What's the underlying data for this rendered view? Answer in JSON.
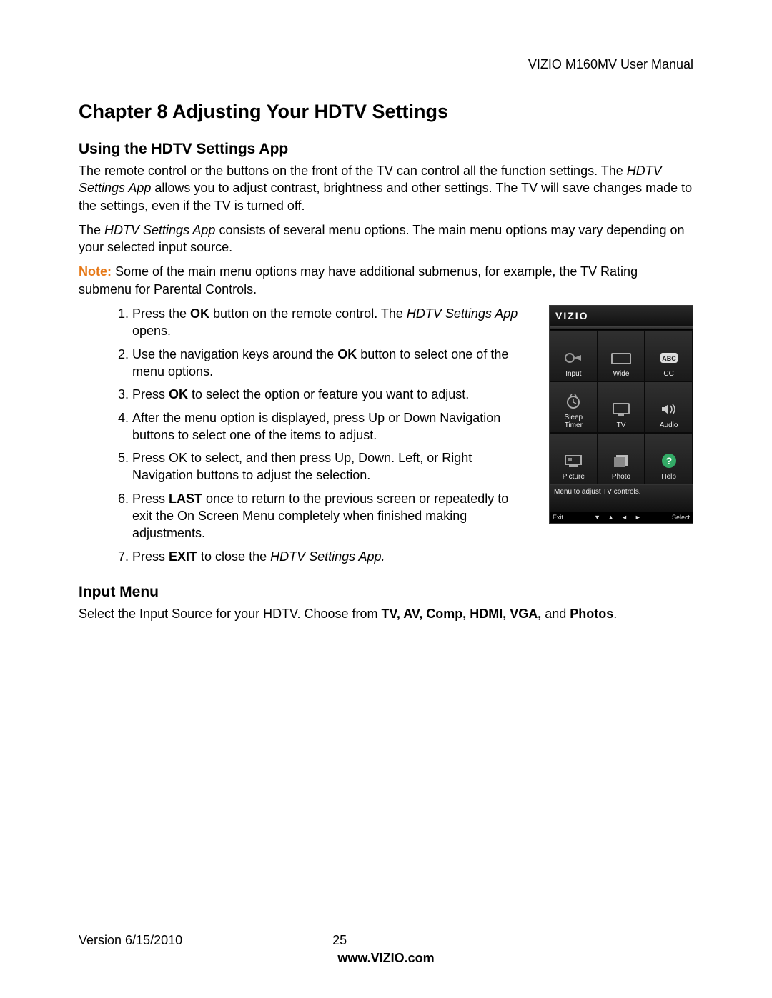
{
  "header": {
    "title": "VIZIO M160MV User Manual"
  },
  "chapter": {
    "title": "Chapter 8 Adjusting Your HDTV Settings"
  },
  "section1": {
    "title": "Using the HDTV Settings App",
    "p1_a": "The remote control or the buttons on the front of the TV can control all the function settings. The ",
    "p1_b": "HDTV Settings App",
    "p1_c": " allows you to adjust contrast, brightness and other settings. The TV will save changes made to the settings, even if the TV is turned off.",
    "p2_a": "The ",
    "p2_b": "HDTV Settings App",
    "p2_c": " consists of several menu options. The main menu options may vary depending on your selected input source.",
    "note_label": "Note:",
    "note_text": "  Some of the main menu options may have additional submenus, for example, the TV Rating submenu for Parental Controls."
  },
  "steps": {
    "s1_a": "Press the ",
    "s1_b": "OK",
    "s1_c": " button on the remote control. The ",
    "s1_d": "HDTV Settings App",
    "s1_e": " opens.",
    "s2_a": "Use the navigation keys around the ",
    "s2_b": "OK",
    "s2_c": " button to select one of the menu options.",
    "s3_a": "Press ",
    "s3_b": "OK",
    "s3_c": " to select the option or feature you want to adjust.",
    "s4": "After the menu option is displayed, press Up or Down Navigation buttons to select one of the items to adjust.",
    "s5": "Press OK to select, and then press Up, Down. Left, or Right Navigation buttons to adjust the selection.",
    "s6_a": "Press ",
    "s6_b": "LAST",
    "s6_c": " once to return to the previous screen or repeatedly to exit the On Screen Menu completely when finished making adjustments.",
    "s7_a": "Press ",
    "s7_b": "EXIT",
    "s7_c": " to close the ",
    "s7_d": "HDTV Settings App.",
    "s7_e": ""
  },
  "osd": {
    "brand": "VIZIO",
    "tiles": [
      {
        "name": "input-tile",
        "label": "Input"
      },
      {
        "name": "wide-tile",
        "label": "Wide"
      },
      {
        "name": "cc-tile",
        "label": "CC"
      },
      {
        "name": "sleep-timer-tile",
        "label": "Sleep\nTimer"
      },
      {
        "name": "tv-tile",
        "label": "TV"
      },
      {
        "name": "audio-tile",
        "label": "Audio"
      },
      {
        "name": "picture-tile",
        "label": "Picture"
      },
      {
        "name": "photo-tile",
        "label": "Photo"
      },
      {
        "name": "help-tile",
        "label": "Help"
      }
    ],
    "message": "Menu to adjust TV controls.",
    "footer": {
      "exit": "Exit",
      "select": "Select"
    }
  },
  "section2": {
    "title": "Input Menu",
    "p_a": "Select the Input Source for your HDTV. Choose from ",
    "p_b": "TV, AV, Comp, HDMI, VGA,",
    "p_c": " and ",
    "p_d": "Photos",
    "p_e": "."
  },
  "footer": {
    "version": "Version 6/15/2010",
    "page": "25",
    "url": "www.VIZIO.com"
  }
}
